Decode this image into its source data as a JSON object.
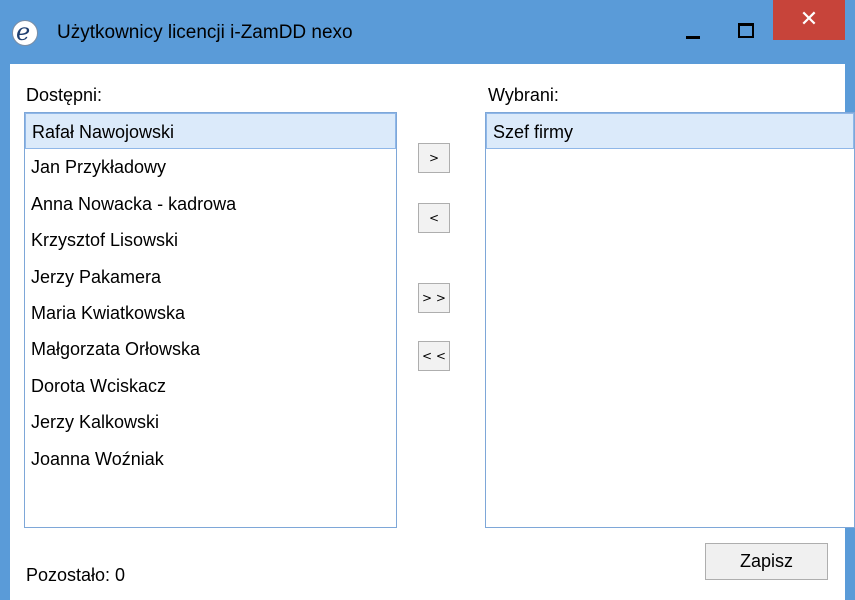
{
  "window": {
    "title": "Użytkownicy licencji i-ZamDD nexo",
    "close_glyph": "✕"
  },
  "available": {
    "label": "Dostępni:",
    "items": [
      "Rafał Nawojowski",
      "Jan Przykładowy",
      "Anna Nowacka - kadrowa",
      "Krzysztof Lisowski",
      "Jerzy Pakamera",
      "Maria Kwiatkowska",
      "Małgorzata Orłowska",
      "Dorota Wciskacz",
      "Jerzy Kalkowski",
      "Joanna Woźniak"
    ],
    "selected_index": 0
  },
  "chosen": {
    "label": "Wybrani:",
    "items": [
      "Szef firmy"
    ],
    "selected_index": 0
  },
  "buttons": {
    "move_right": ">",
    "move_left": "<",
    "move_all_right": "> >",
    "move_all_left": "< <",
    "save": "Zapisz"
  },
  "footer": {
    "remaining": "Pozostało: 0"
  },
  "colors": {
    "titlebar": "#5a9bd8",
    "close": "#c7443a",
    "selection": "#dbeafa"
  }
}
